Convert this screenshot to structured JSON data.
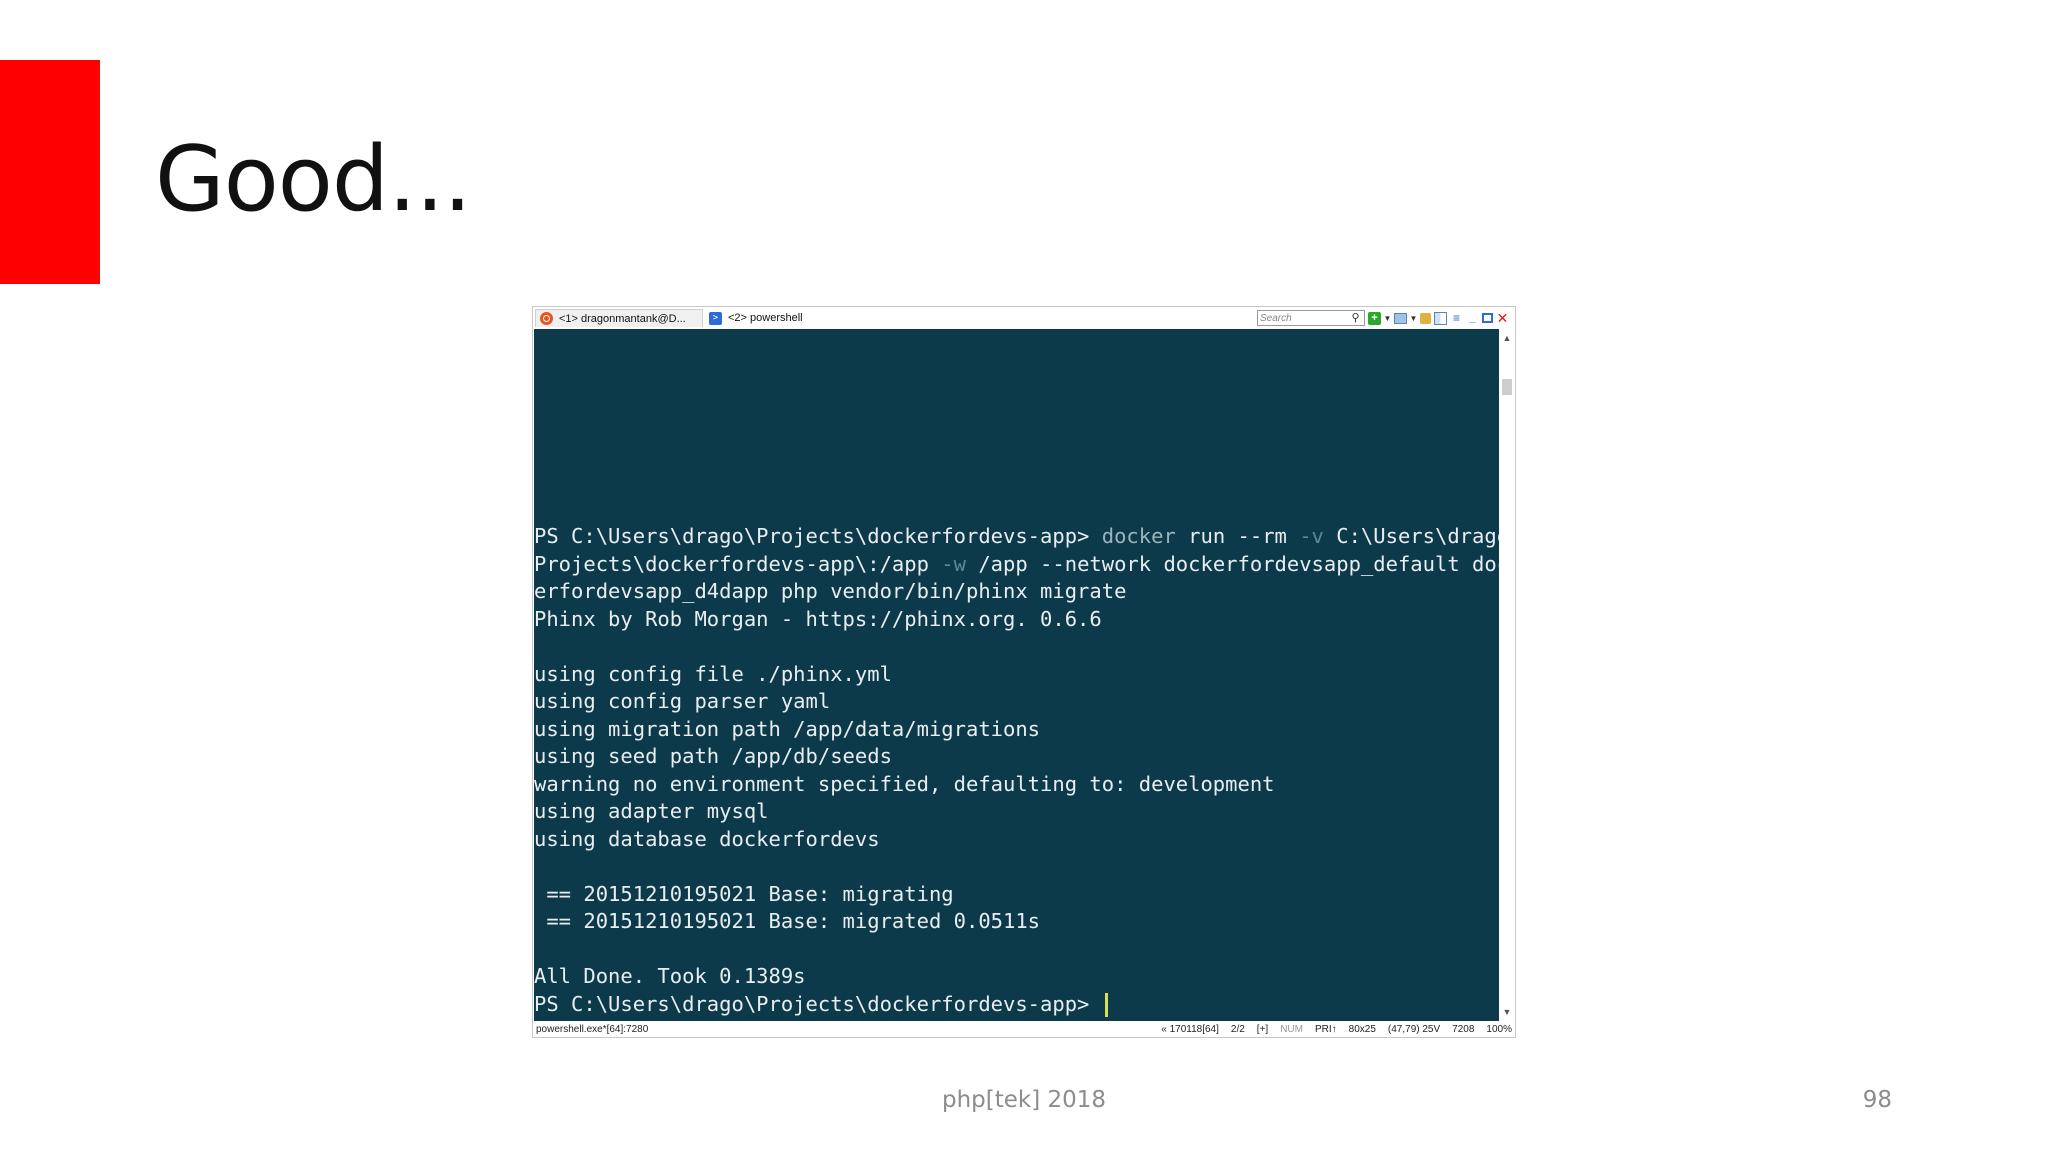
{
  "slide": {
    "title": "Good...",
    "footer": "php[tek] 2018",
    "page_number": "98",
    "accent_color": "#ff0000"
  },
  "terminal": {
    "tabs": [
      {
        "label": "<1> dragonmantank@D...",
        "icon": "ubuntu-icon"
      },
      {
        "label": "<2> powershell",
        "icon": "powershell-icon"
      }
    ],
    "search_placeholder": "Search",
    "background_color": "#0d3a4a",
    "lines": [
      {
        "segments": [
          {
            "text": "PS C:\\Users\\drago\\Projects\\dockerfordevs-app> ",
            "style": "normal"
          },
          {
            "text": "docker",
            "style": "soft"
          },
          {
            "text": " run --rm ",
            "style": "normal"
          },
          {
            "text": "-v",
            "style": "dim"
          },
          {
            "text": " C:\\Users\\drago",
            "style": "normal"
          }
        ]
      },
      {
        "segments": [
          {
            "text": "Projects\\dockerfordevs-app\\:/app ",
            "style": "normal"
          },
          {
            "text": "-w",
            "style": "dim"
          },
          {
            "text": " /app --network dockerfordevsapp_default doc",
            "style": "normal"
          }
        ]
      },
      {
        "segments": [
          {
            "text": "erfordevsapp_d4dapp php vendor/bin/phinx migrate",
            "style": "normal"
          }
        ]
      },
      {
        "segments": [
          {
            "text": "Phinx by Rob Morgan - https://phinx.org. 0.6.6",
            "style": "normal"
          }
        ]
      },
      {
        "segments": [
          {
            "text": "",
            "style": "normal"
          }
        ]
      },
      {
        "segments": [
          {
            "text": "using config file ./phinx.yml",
            "style": "normal"
          }
        ]
      },
      {
        "segments": [
          {
            "text": "using config parser yaml",
            "style": "normal"
          }
        ]
      },
      {
        "segments": [
          {
            "text": "using migration path /app/data/migrations",
            "style": "normal"
          }
        ]
      },
      {
        "segments": [
          {
            "text": "using seed path /app/db/seeds",
            "style": "normal"
          }
        ]
      },
      {
        "segments": [
          {
            "text": "warning no environment specified, defaulting to: development",
            "style": "normal"
          }
        ]
      },
      {
        "segments": [
          {
            "text": "using adapter mysql",
            "style": "normal"
          }
        ]
      },
      {
        "segments": [
          {
            "text": "using database dockerfordevs",
            "style": "normal"
          }
        ]
      },
      {
        "segments": [
          {
            "text": "",
            "style": "normal"
          }
        ]
      },
      {
        "segments": [
          {
            "text": " == 20151210195021 Base: migrating",
            "style": "normal"
          }
        ]
      },
      {
        "segments": [
          {
            "text": " == 20151210195021 Base: migrated 0.0511s",
            "style": "normal"
          }
        ]
      },
      {
        "segments": [
          {
            "text": "",
            "style": "normal"
          }
        ]
      },
      {
        "segments": [
          {
            "text": "All Done. Took 0.1389s",
            "style": "normal"
          }
        ]
      },
      {
        "segments": [
          {
            "text": "PS C:\\Users\\drago\\Projects\\dockerfordevs-app> ",
            "style": "normal"
          }
        ],
        "cursor": true
      }
    ],
    "status_left": "powershell.exe*[64]:7280",
    "status_items": [
      {
        "text": "« 170118[64]",
        "dim": false
      },
      {
        "text": "2/2",
        "dim": false
      },
      {
        "text": "[+]",
        "dim": false
      },
      {
        "text": "NUM",
        "dim": true
      },
      {
        "text": "PRI↑",
        "dim": false
      },
      {
        "text": "80x25",
        "dim": false
      },
      {
        "text": "(47,79) 25V",
        "dim": false
      },
      {
        "text": "7208",
        "dim": false
      },
      {
        "text": "100%",
        "dim": false
      }
    ]
  }
}
